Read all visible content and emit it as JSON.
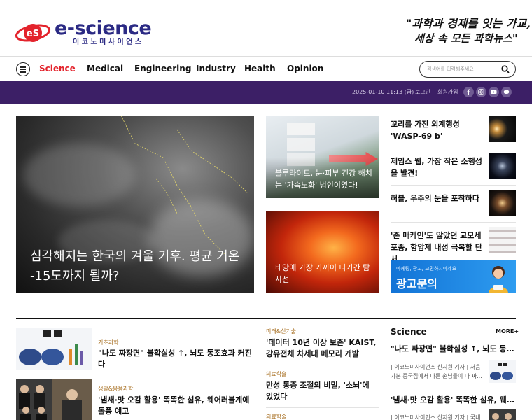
{
  "brand": {
    "mark": "eS",
    "name": "e-science",
    "sub": "이코노미사이언스",
    "slogan_line1": "\"과학과 경제를 잇는 가교,",
    "slogan_line2": "세상 속 모든 과학뉴스\""
  },
  "nav": {
    "items": [
      "Science",
      "Medical",
      "Engineering",
      "Industry",
      "Health",
      "Opinion"
    ],
    "active": "Science",
    "search_placeholder": "검색어를 입력해주세요"
  },
  "topbar": {
    "datetime": "2025-01-10 11:13 (금)",
    "login": "로그인",
    "join": "회원가입",
    "sns": [
      "facebook-icon",
      "instagram-icon",
      "youtube-icon",
      "kakao-icon"
    ]
  },
  "hero": {
    "title": "심각해지는 한국의 겨울 기후. 평균 기온 -15도까지 될까?"
  },
  "mid_cards": [
    {
      "title": "블루라이트, 눈·피부 건강 해치는 '가속노화' 범인이였다!"
    },
    {
      "title": "태양에 가장 가까이 다가간 탐사선"
    }
  ],
  "right_list": [
    {
      "title": "꼬리를 가진 외계행성 'WASP-69 b'"
    },
    {
      "title": "제임스 웹, 가장 작은 소행성을 발견!"
    },
    {
      "title": "허블, 우주의 눈을 포착하다"
    },
    {
      "title": "'존 매케인'도 앓았던 교모세포종, 항암제 내성 극복할 단서..."
    }
  ],
  "ad": {
    "small": "마케팅, 광고, 고민하지마세요",
    "big": "광고문의"
  },
  "bottom_left": [
    {
      "category": "기초과학",
      "title": "\"나도 짜장면\" 불확실성 ↑, 뇌도 동조효과 커진다"
    },
    {
      "category": "생활&응용과학",
      "title": "'냄새·맛 오감 활용' 똑똑한 섬유, 웨어러블계에 돌풍 예고"
    }
  ],
  "bottom_mid": [
    {
      "category": "미래&신기술",
      "title": "'데이터 10년 이상 보존' KAIST, 강유전체 차세대 메모리 개발"
    },
    {
      "category": "의료학술",
      "title": "만성 통증 조절의 비밀, '소뇌'에 있었다"
    },
    {
      "category": "의료학술",
      "title": ""
    }
  ],
  "bottom_right": {
    "heading": "Science",
    "more": "MORE+",
    "items": [
      {
        "title": "\"나도 짜장면\" 불확실성 ↑, 뇌도 동조...",
        "desc": "| 이코노미사이언스 신지원 기자 | 처음 가본 중국집에서 다른 손님들이 다 짜..."
      },
      {
        "title": "'냄새·맛 오감 활용' 똑똑한 섬유, 웨어...",
        "desc": "| 이코노미사이언스 신지원 기자 | 국내"
      }
    ]
  }
}
